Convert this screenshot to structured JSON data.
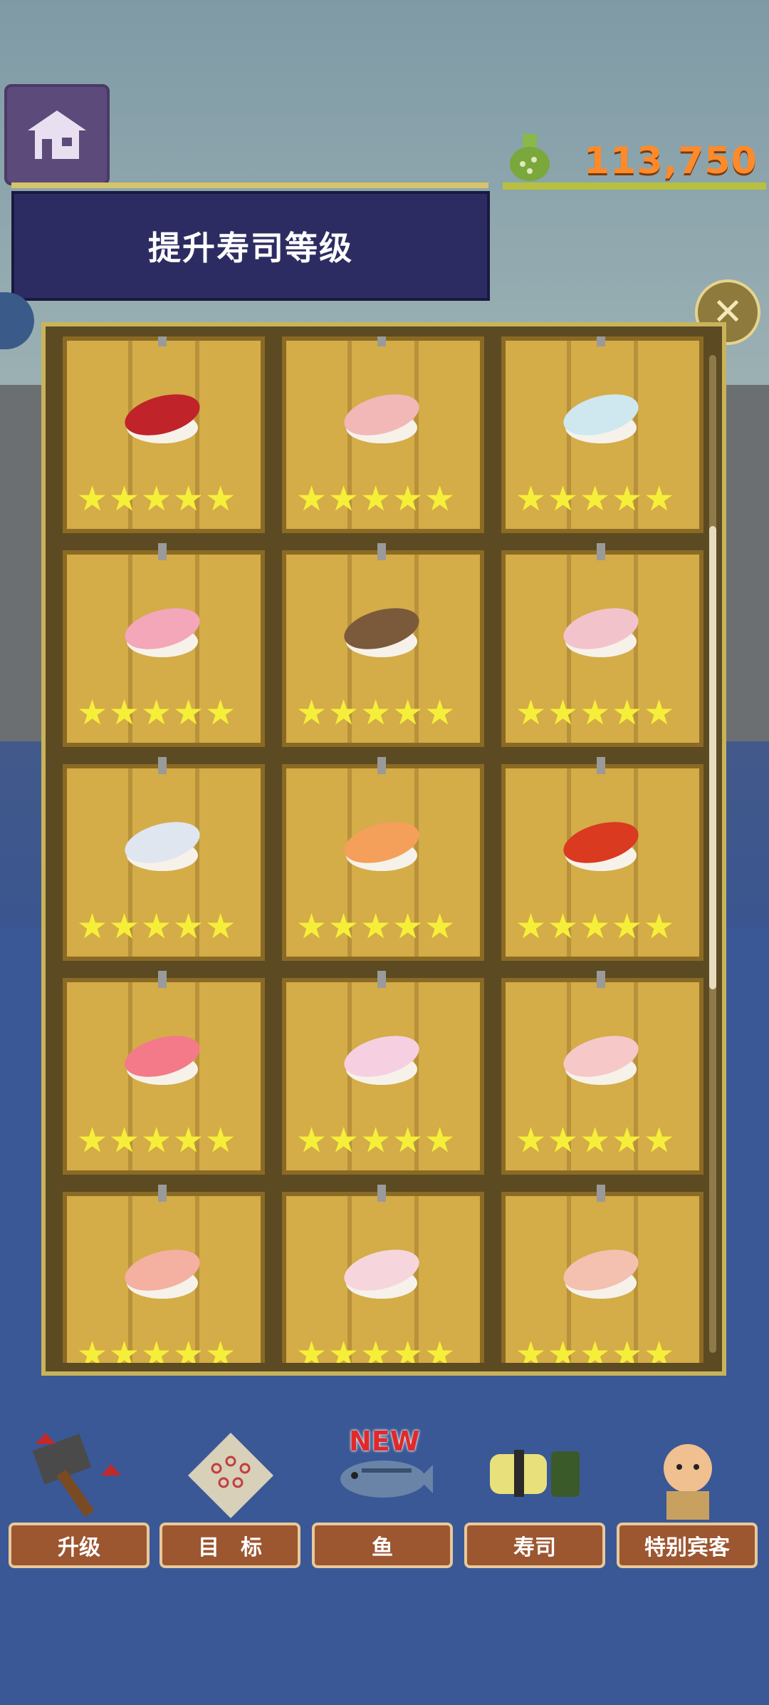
{
  "header": {
    "title": "提升寿司等级",
    "money": "113,750"
  },
  "icons": {
    "home": "home-icon",
    "close": "close-icon",
    "money_bag": "money-bag-icon"
  },
  "close_glyph": "✕",
  "cards": [
    {
      "name": "tuna-sushi",
      "stars": 5,
      "color": "#c0232a"
    },
    {
      "name": "sea-bream-sushi",
      "stars": 5,
      "color": "#f2b8b8"
    },
    {
      "name": "squid-sushi",
      "stars": 5,
      "color": "#cfe8f0"
    },
    {
      "name": "yellowtail-sushi",
      "stars": 5,
      "color": "#f3a7b8"
    },
    {
      "name": "eel-sushi",
      "stars": 5,
      "color": "#7a5a3a"
    },
    {
      "name": "octopus-sushi",
      "stars": 5,
      "color": "#f3c3cc"
    },
    {
      "name": "mackerel-sushi",
      "stars": 5,
      "color": "#dfe6f0"
    },
    {
      "name": "salmon-sushi",
      "stars": 5,
      "color": "#f4a05a"
    },
    {
      "name": "salmon-roe-gunkan",
      "stars": 5,
      "color": "#d93a20"
    },
    {
      "name": "medium-tuna-sushi",
      "stars": 5,
      "color": "#f47a8a"
    },
    {
      "name": "flounder-sushi",
      "stars": 5,
      "color": "#f6d0e0"
    },
    {
      "name": "snapper-sushi",
      "stars": 5,
      "color": "#f6c8c8"
    },
    {
      "name": "shrimp-sushi",
      "stars": 5,
      "color": "#f4b0a0"
    },
    {
      "name": "scallop-sushi",
      "stars": 5,
      "color": "#f6d6dc"
    },
    {
      "name": "sweet-shrimp-sushi",
      "stars": 5,
      "color": "#f4c0b0"
    }
  ],
  "star_glyph": "★",
  "nav": [
    {
      "label": "升级",
      "icon": "hammer-icon"
    },
    {
      "label": "目　标",
      "icon": "target-sheet-icon"
    },
    {
      "label": "鱼",
      "icon": "fish-icon"
    },
    {
      "label": "寿司",
      "icon": "sushi-icon"
    },
    {
      "label": "特别宾客",
      "icon": "guest-icon"
    }
  ],
  "new_badge": "NEW",
  "colors": {
    "banner": "#2d2c62",
    "money": "#ff8a2a",
    "star": "#f6ef3a",
    "card": "#d4ac48",
    "nav_label": "#9c5630"
  }
}
